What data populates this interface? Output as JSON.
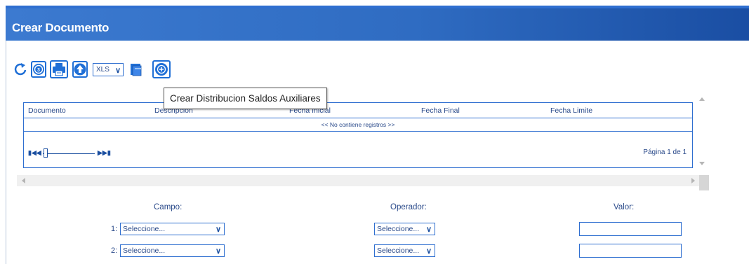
{
  "window": {
    "title": "Crear Documento"
  },
  "toolbar": {
    "export_format": "XLS",
    "tooltip": "Crear Distribucion Saldos Auxiliares",
    "icons": [
      "refresh-icon",
      "info-icon",
      "print-icon",
      "upload-icon",
      "export-icon",
      "add-icon"
    ]
  },
  "grid": {
    "columns": [
      "Documento",
      "Descripcion",
      "Fecha Inicial",
      "Fecha Final",
      "Fecha Limite"
    ],
    "empty_message": "<< No contiene registros >>",
    "page_info": "Página 1 de 1"
  },
  "filters": {
    "labels": {
      "campo": "Campo:",
      "operador": "Operador:",
      "valor": "Valor:"
    },
    "rows": [
      {
        "num": "1:",
        "campo": "Seleccione...",
        "operador": "Seleccione...",
        "valor": ""
      },
      {
        "num": "2:",
        "campo": "Seleccione...",
        "operador": "Seleccione...",
        "valor": ""
      }
    ]
  },
  "colors": {
    "accent": "#2f6fd0",
    "title_bar": "#2f6cc2",
    "text": "#2a4a8a"
  }
}
